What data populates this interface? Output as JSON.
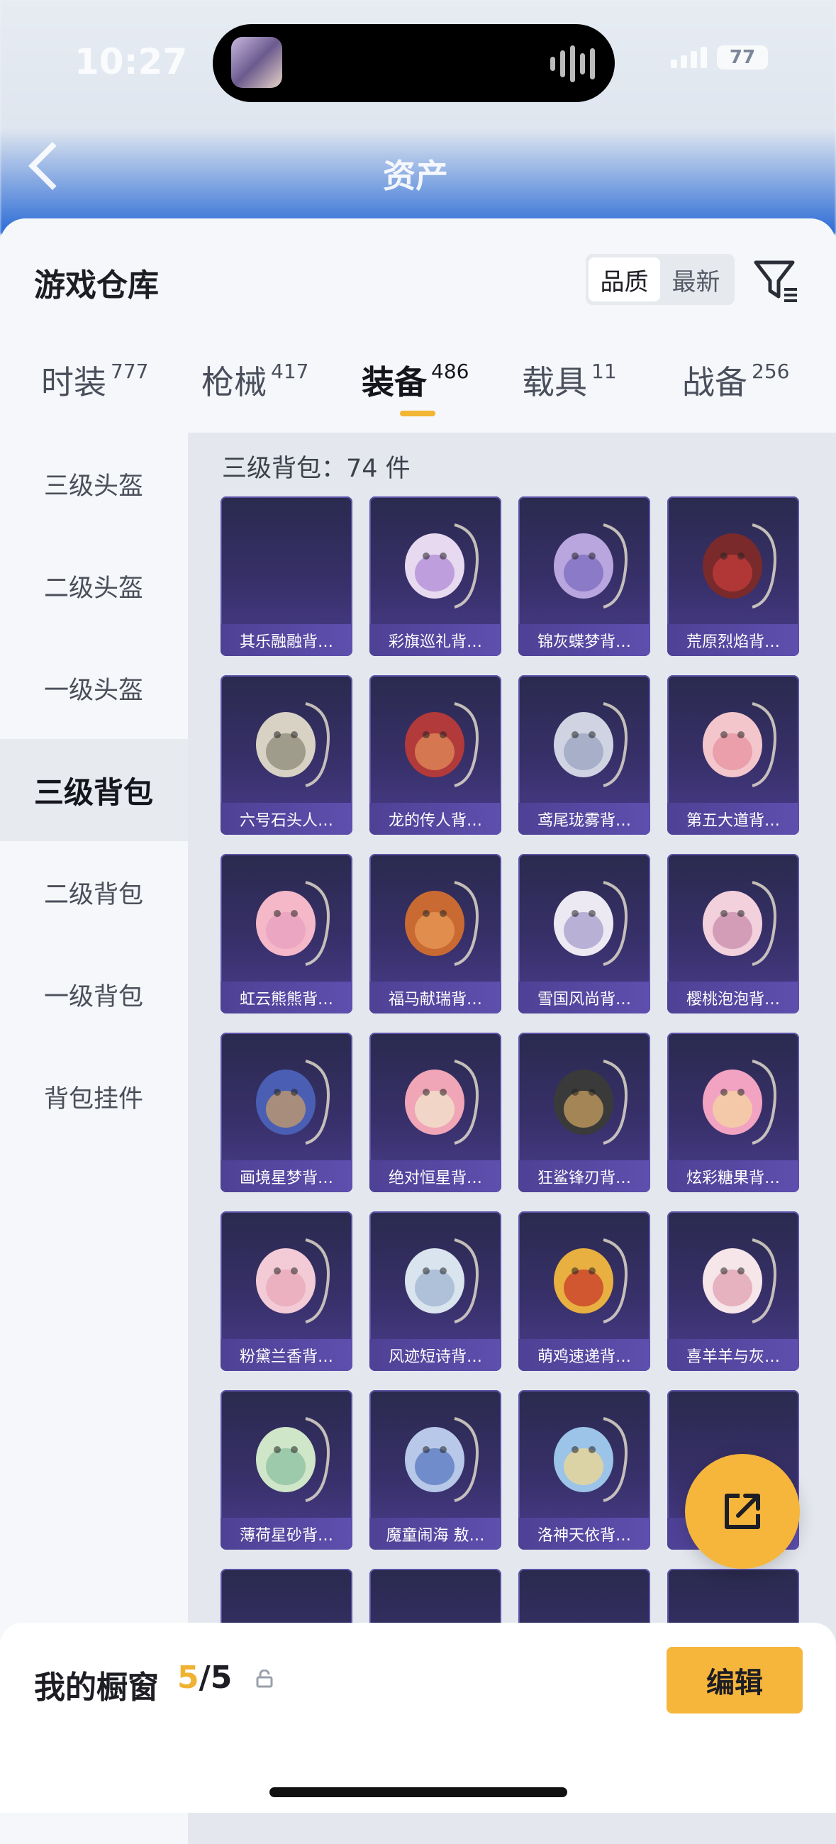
{
  "status_bar": {
    "time": "10:27",
    "battery": "77"
  },
  "header": {
    "title": "资产"
  },
  "sheet": {
    "title": "游戏仓库",
    "sort_options": [
      "品质",
      "最新"
    ],
    "sort_active": "品质"
  },
  "tabs": [
    {
      "label": "时装",
      "count": "777"
    },
    {
      "label": "枪械",
      "count": "417"
    },
    {
      "label": "装备",
      "count": "486"
    },
    {
      "label": "载具",
      "count": "11"
    },
    {
      "label": "战备",
      "count": "256"
    }
  ],
  "active_tab": "装备",
  "sidebar": {
    "items": [
      "三级头盔",
      "二级头盔",
      "一级头盔",
      "三级背包",
      "二级背包",
      "一级背包",
      "背包挂件"
    ],
    "active": "三级背包"
  },
  "content": {
    "title": "三级背包：74 件",
    "items": [
      "其乐融融背…",
      "彩旗巡礼背…",
      "锦灰蝶梦背…",
      "荒原烈焰背…",
      "六号石头人…",
      "龙的传人背…",
      "鸢尾珑雾背…",
      "第五大道背…",
      "虹云熊熊背…",
      "福马献瑞背…",
      "雪国风尚背…",
      "樱桃泡泡背…",
      "画境星梦背…",
      "绝对恒星背…",
      "狂鲨锋刃背…",
      "炫彩糖果背…",
      "粉黛兰香背…",
      "风迹短诗背…",
      "萌鸡速递背…",
      "喜羊羊与灰…",
      "薄荷星砂背…",
      "魔童闹海 敖…",
      "洛神天依背…",
      ""
    ]
  },
  "bottom_bar": {
    "showcase_label": "我的橱窗",
    "showcase_current": "5",
    "showcase_total": "/5",
    "edit_label": "编辑"
  },
  "colors": {
    "accent": "#f5b63b",
    "card_bg": "#38306a",
    "card_label": "#5e4fae"
  }
}
